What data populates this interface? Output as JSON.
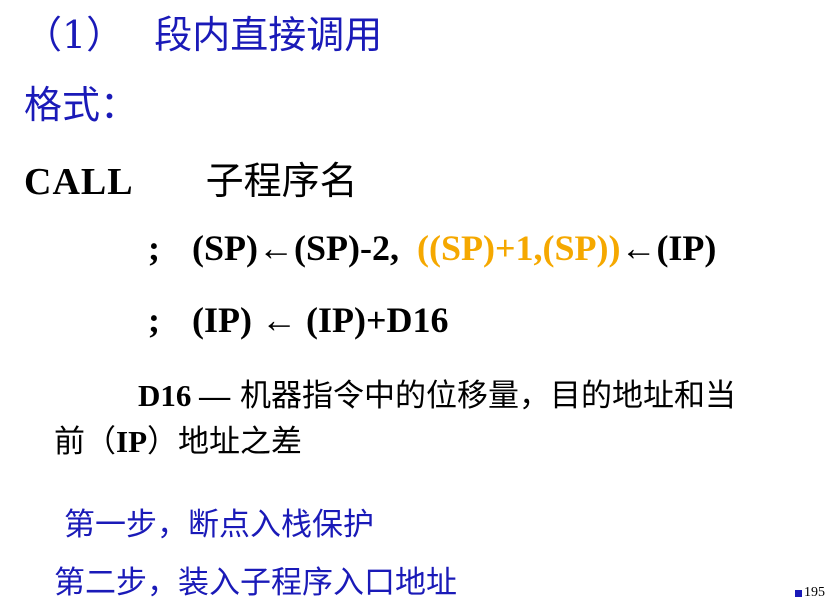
{
  "title": {
    "number": "（1）",
    "text": "段内直接调用"
  },
  "format_label": "格式：",
  "call": {
    "keyword": "CALL",
    "operand": "子程序名"
  },
  "formula_line1": {
    "semicolon": ";",
    "part1": "(SP)←(SP)-2,",
    "part2_highlight": "((SP)+1,(SP))",
    "part3": "←(IP)"
  },
  "formula_line2": {
    "semicolon": ";",
    "text": "(IP) ← (IP)+D16"
  },
  "description": {
    "lead": "D16 —",
    "line1_rest": " 机器指令中的位移量，目的地址和当",
    "line2_start": "前（",
    "line2_ip": "IP",
    "line2_end": "）地址之差"
  },
  "steps": {
    "step1": "第一步，断点入栈保护",
    "step2": "第二步，装入子程序入口地址"
  },
  "page_number": "195",
  "colors": {
    "heading_blue": "#1a1ab8",
    "highlight_orange": "#f5a800",
    "text_black": "#000000"
  }
}
